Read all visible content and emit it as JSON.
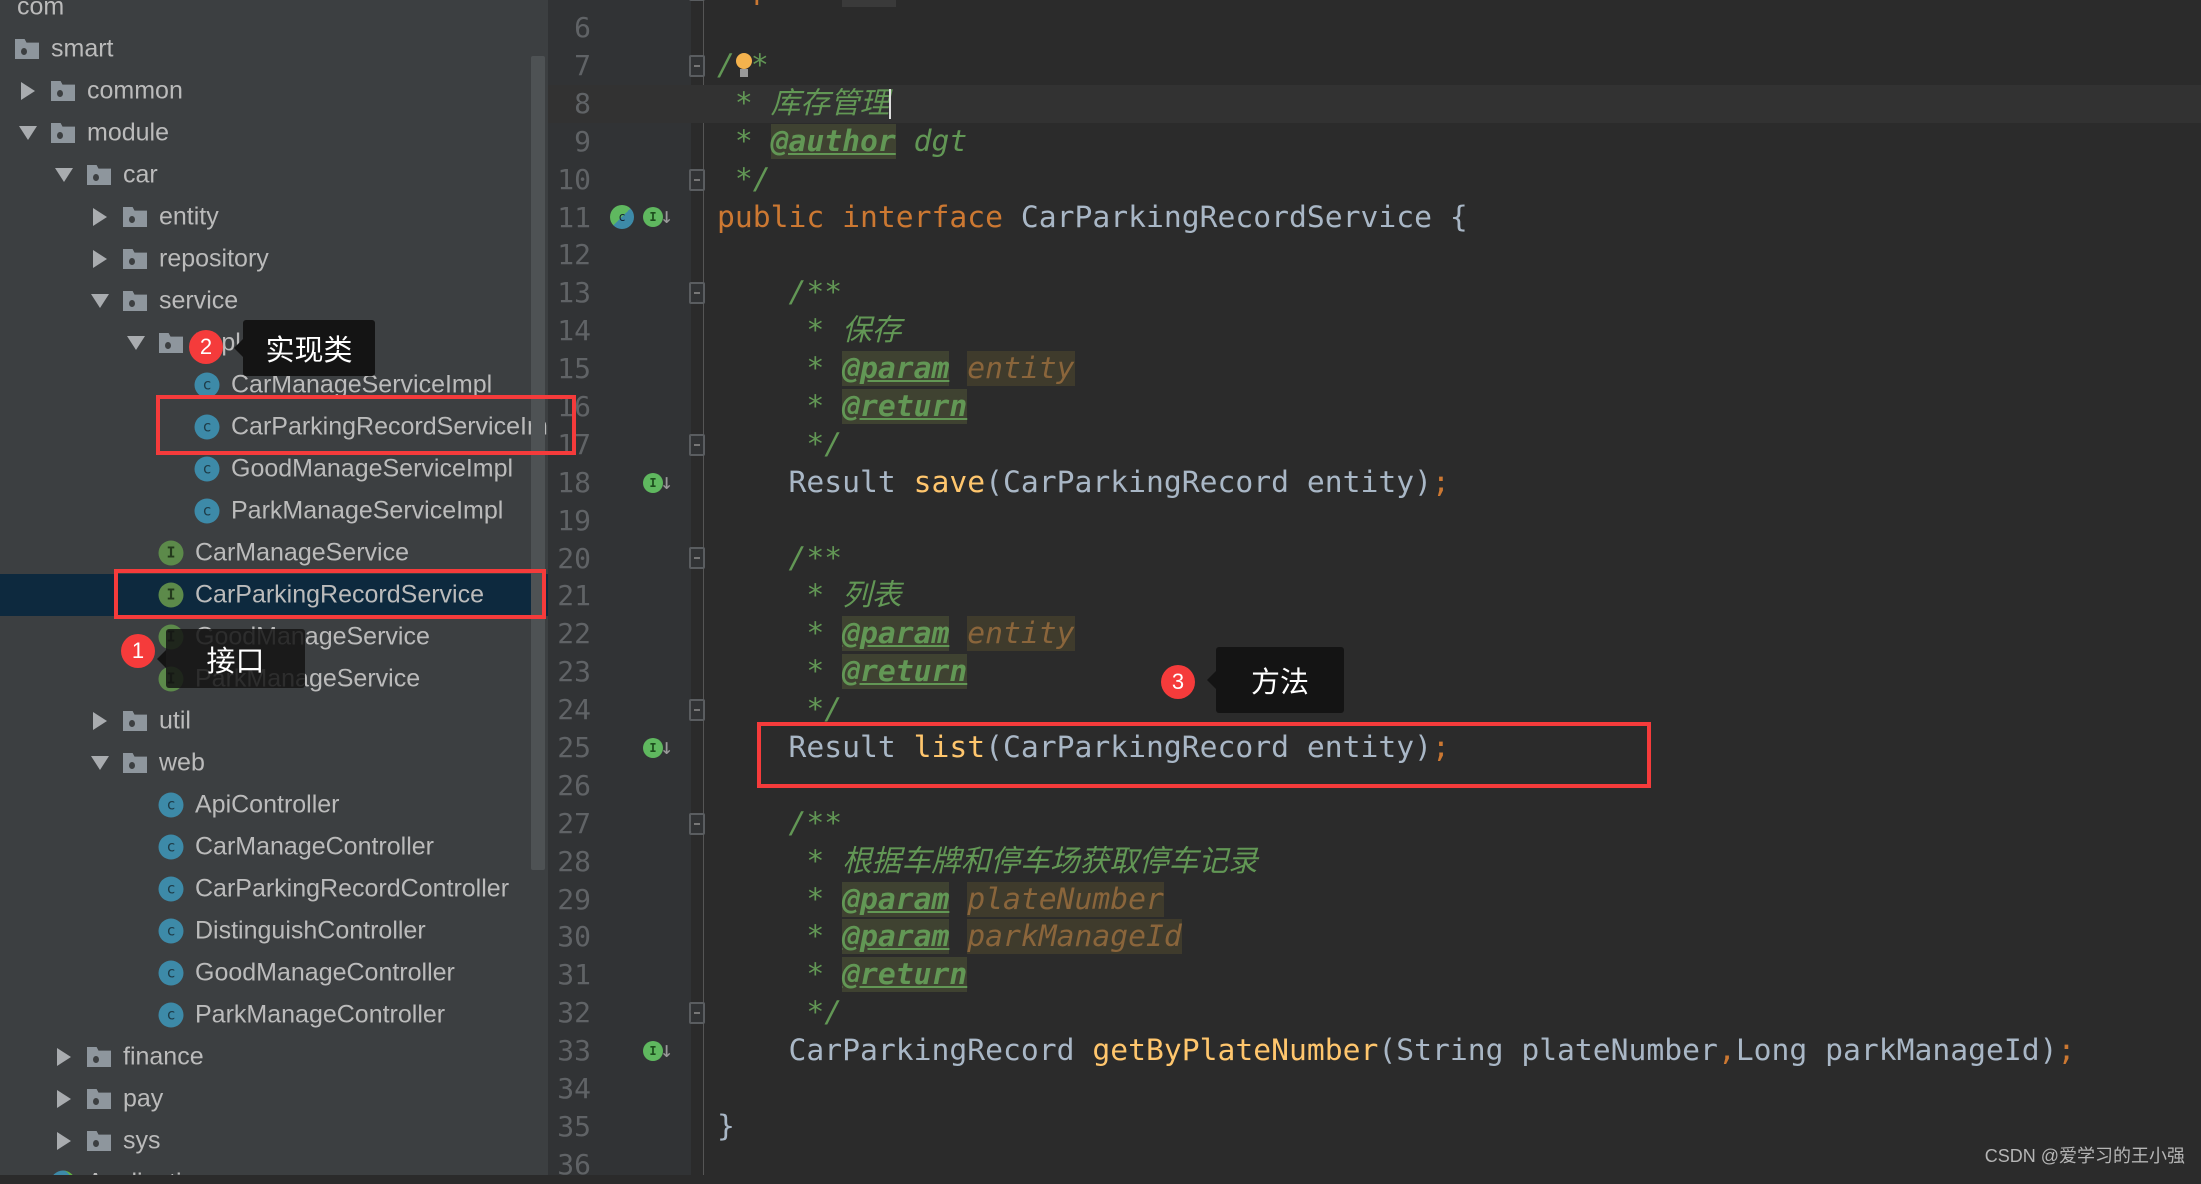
{
  "project_tree": [
    {
      "label": "com",
      "kind": "none",
      "level": 0
    },
    {
      "label": "smart",
      "kind": "folder",
      "level": 0
    },
    {
      "label": "common",
      "kind": "folder",
      "level": 1,
      "arrow": "right"
    },
    {
      "label": "module",
      "kind": "folder",
      "level": 1,
      "arrow": "down"
    },
    {
      "label": "car",
      "kind": "folder",
      "level": 2,
      "arrow": "down"
    },
    {
      "label": "entity",
      "kind": "folder",
      "level": 3,
      "arrow": "right"
    },
    {
      "label": "repository",
      "kind": "folder",
      "level": 3,
      "arrow": "right"
    },
    {
      "label": "service",
      "kind": "folder",
      "level": 3,
      "arrow": "down"
    },
    {
      "label": "impl",
      "kind": "folder",
      "level": 4,
      "arrow": "down"
    },
    {
      "label": "CarManageServiceImpl",
      "kind": "class",
      "level": 5
    },
    {
      "label": "CarParkingRecordServiceImpl",
      "kind": "class",
      "level": 5
    },
    {
      "label": "GoodManageServiceImpl",
      "kind": "class",
      "level": 5
    },
    {
      "label": "ParkManageServiceImpl",
      "kind": "class",
      "level": 5
    },
    {
      "label": "CarManageService",
      "kind": "interface",
      "level": 4
    },
    {
      "label": "CarParkingRecordService",
      "kind": "interface",
      "level": 4,
      "selected": true
    },
    {
      "label": "GoodManageService",
      "kind": "interface",
      "level": 4
    },
    {
      "label": "ParkManageService",
      "kind": "interface",
      "level": 4
    },
    {
      "label": "util",
      "kind": "folder",
      "level": 3,
      "arrow": "right"
    },
    {
      "label": "web",
      "kind": "folder",
      "level": 3,
      "arrow": "down"
    },
    {
      "label": "ApiController",
      "kind": "class",
      "level": 4
    },
    {
      "label": "CarManageController",
      "kind": "class",
      "level": 4
    },
    {
      "label": "CarParkingRecordController",
      "kind": "class",
      "level": 4
    },
    {
      "label": "DistinguishController",
      "kind": "class",
      "level": 4
    },
    {
      "label": "GoodManageController",
      "kind": "class",
      "level": 4
    },
    {
      "label": "ParkManageController",
      "kind": "class",
      "level": 4
    },
    {
      "label": "finance",
      "kind": "folder",
      "level": 2,
      "arrow": "right"
    },
    {
      "label": "pay",
      "kind": "folder",
      "level": 2,
      "arrow": "right"
    },
    {
      "label": "sys",
      "kind": "folder",
      "level": 2,
      "arrow": "right"
    },
    {
      "label": "Application",
      "kind": "app",
      "level": 1
    }
  ],
  "icon_letters": {
    "class": "c",
    "interface": "I"
  },
  "editor": {
    "current_line": 8,
    "lines": [
      {
        "n": 5,
        "fold": true,
        "tokens": [
          {
            "c": "kw",
            "t": "import "
          },
          {
            "c": "fd",
            "t": "..."
          }
        ]
      },
      {
        "n": 6,
        "tokens": []
      },
      {
        "n": 7,
        "fold": true,
        "tokens": [
          {
            "c": "cm",
            "t": "/"
          },
          {
            "c": "bulb",
            "t": ""
          },
          {
            "c": "cm",
            "t": "*"
          }
        ]
      },
      {
        "n": 8,
        "tokens": [
          {
            "c": "cm",
            "t": " * 库存管理"
          },
          {
            "c": "caret",
            "t": ""
          }
        ]
      },
      {
        "n": 9,
        "tokens": [
          {
            "c": "cm",
            "t": " * "
          },
          {
            "c": "tag",
            "t": "@author"
          },
          {
            "c": "cm",
            "t": " dgt"
          }
        ]
      },
      {
        "n": 10,
        "fold": true,
        "tokens": [
          {
            "c": "cm",
            "t": " */"
          }
        ]
      },
      {
        "n": 11,
        "gutter": [
          "implemented",
          "implementing"
        ],
        "tokens": [
          {
            "c": "kw",
            "t": "public interface "
          },
          {
            "c": "tx",
            "t": "CarParkingRecordService {"
          }
        ]
      },
      {
        "n": 12,
        "tokens": []
      },
      {
        "n": 13,
        "fold": true,
        "tokens": [
          {
            "c": "cm",
            "t": "    /**"
          }
        ]
      },
      {
        "n": 14,
        "tokens": [
          {
            "c": "cm",
            "t": "     * 保存"
          }
        ]
      },
      {
        "n": 15,
        "tokens": [
          {
            "c": "cm",
            "t": "     * "
          },
          {
            "c": "tag",
            "t": "@param"
          },
          {
            "c": "cm",
            "t": " "
          },
          {
            "c": "pv",
            "t": "entity"
          }
        ]
      },
      {
        "n": 16,
        "tokens": [
          {
            "c": "cm",
            "t": "     * "
          },
          {
            "c": "tag",
            "t": "@return"
          }
        ]
      },
      {
        "n": 17,
        "fold": true,
        "tokens": [
          {
            "c": "cm",
            "t": "     */"
          }
        ]
      },
      {
        "n": 18,
        "gutter": [
          "implemented"
        ],
        "tokens": [
          {
            "c": "tx",
            "t": "    Result "
          },
          {
            "c": "fn",
            "t": "save"
          },
          {
            "c": "tx",
            "t": "(CarParkingRecord entity)"
          },
          {
            "c": "sc",
            "t": ";"
          }
        ]
      },
      {
        "n": 19,
        "tokens": []
      },
      {
        "n": 20,
        "fold": true,
        "tokens": [
          {
            "c": "cm",
            "t": "    /**"
          }
        ]
      },
      {
        "n": 21,
        "tokens": [
          {
            "c": "cm",
            "t": "     * 列表"
          }
        ]
      },
      {
        "n": 22,
        "tokens": [
          {
            "c": "cm",
            "t": "     * "
          },
          {
            "c": "tag",
            "t": "@param"
          },
          {
            "c": "cm",
            "t": " "
          },
          {
            "c": "pv",
            "t": "entity"
          }
        ]
      },
      {
        "n": 23,
        "tokens": [
          {
            "c": "cm",
            "t": "     * "
          },
          {
            "c": "tag",
            "t": "@return"
          }
        ]
      },
      {
        "n": 24,
        "fold": true,
        "tokens": [
          {
            "c": "cm",
            "t": "     */"
          }
        ]
      },
      {
        "n": 25,
        "gutter": [
          "implemented"
        ],
        "tokens": [
          {
            "c": "tx",
            "t": "    Result "
          },
          {
            "c": "fn",
            "t": "list"
          },
          {
            "c": "tx",
            "t": "(CarParkingRecord entity)"
          },
          {
            "c": "sc",
            "t": ";"
          }
        ]
      },
      {
        "n": 26,
        "tokens": []
      },
      {
        "n": 27,
        "fold": true,
        "tokens": [
          {
            "c": "cm",
            "t": "    /**"
          }
        ]
      },
      {
        "n": 28,
        "tokens": [
          {
            "c": "cm",
            "t": "     * 根据车牌和停车场获取停车记录"
          }
        ]
      },
      {
        "n": 29,
        "tokens": [
          {
            "c": "cm",
            "t": "     * "
          },
          {
            "c": "tag",
            "t": "@param"
          },
          {
            "c": "cm",
            "t": " "
          },
          {
            "c": "pv",
            "t": "plateNumber"
          }
        ]
      },
      {
        "n": 30,
        "tokens": [
          {
            "c": "cm",
            "t": "     * "
          },
          {
            "c": "tag",
            "t": "@param"
          },
          {
            "c": "cm",
            "t": " "
          },
          {
            "c": "pv",
            "t": "parkManageId"
          }
        ]
      },
      {
        "n": 31,
        "tokens": [
          {
            "c": "cm",
            "t": "     * "
          },
          {
            "c": "tag",
            "t": "@return"
          }
        ]
      },
      {
        "n": 32,
        "fold": true,
        "tokens": [
          {
            "c": "cm",
            "t": "     */"
          }
        ]
      },
      {
        "n": 33,
        "gutter": [
          "implemented"
        ],
        "tokens": [
          {
            "c": "tx",
            "t": "    CarParkingRecord "
          },
          {
            "c": "fn",
            "t": "getByPlateNumber"
          },
          {
            "c": "tx",
            "t": "(String plateNumber"
          },
          {
            "c": "sc",
            "t": ","
          },
          {
            "c": "tx",
            "t": "Long parkManageId)"
          },
          {
            "c": "sc",
            "t": ";"
          }
        ]
      },
      {
        "n": 34,
        "tokens": []
      },
      {
        "n": 35,
        "tokens": [
          {
            "c": "tx",
            "t": "}"
          }
        ]
      },
      {
        "n": 36,
        "tokens": []
      }
    ]
  },
  "annotations": [
    {
      "number": "1",
      "label": "接口"
    },
    {
      "number": "2",
      "label": "实现类"
    },
    {
      "number": "3",
      "label": "方法"
    }
  ],
  "colors": {
    "highlight_box": "#f53b3b",
    "badge": "#f53b3b",
    "selection": "#0d293e"
  },
  "watermark": "CSDN @爱学习的王小强"
}
